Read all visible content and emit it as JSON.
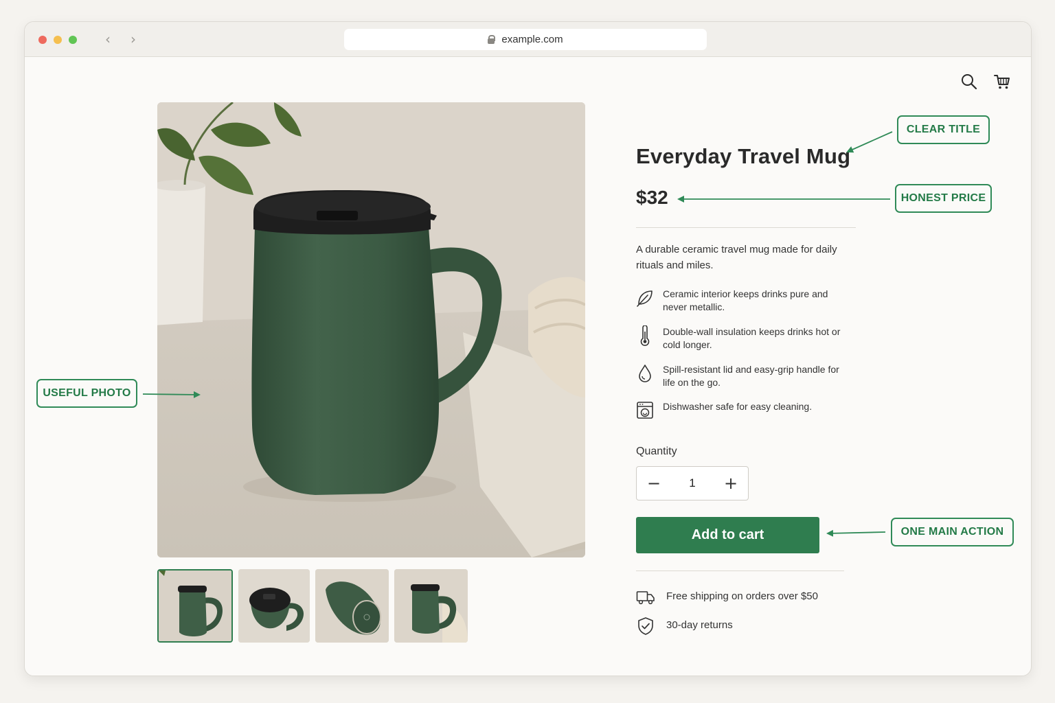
{
  "browser": {
    "url": "example.com",
    "back_icon": "‹",
    "forward_icon": "›"
  },
  "header": {
    "search_icon": "search-icon",
    "cart_icon": "cart-icon"
  },
  "product": {
    "title": "Everyday Travel Mug",
    "price": "$32",
    "description": "A durable ceramic travel mug made for daily rituals and miles.",
    "features": [
      {
        "icon": "leaf-icon",
        "text": "Ceramic interior keeps drinks pure and never metallic."
      },
      {
        "icon": "thermometer-icon",
        "text": "Double-wall insulation keeps drinks hot or cold longer."
      },
      {
        "icon": "droplet-icon",
        "text": "Spill-resistant lid and easy-grip handle for life on the go."
      },
      {
        "icon": "dishwasher-icon",
        "text": "Dishwasher safe for easy cleaning."
      }
    ],
    "quantity_label": "Quantity",
    "quantity_value": "1",
    "minus_label": "−",
    "plus_label": "+",
    "add_to_cart_label": "Add to cart",
    "shipping_text": "Free shipping on orders over $50",
    "returns_text": "30-day returns",
    "thumbnails_count": 4,
    "selected_thumbnail": 1
  },
  "callouts": {
    "clear_title": "CLEAR TITLE",
    "honest_price": "HONEST PRICE",
    "useful_photo": "USEFUL PHOTO",
    "one_main_action": "ONE MAIN ACTION"
  },
  "colors": {
    "accent": "#2f7d4f",
    "callout": "#2f8a57",
    "mug": "#3e5c45",
    "lid": "#1e1e1e"
  }
}
